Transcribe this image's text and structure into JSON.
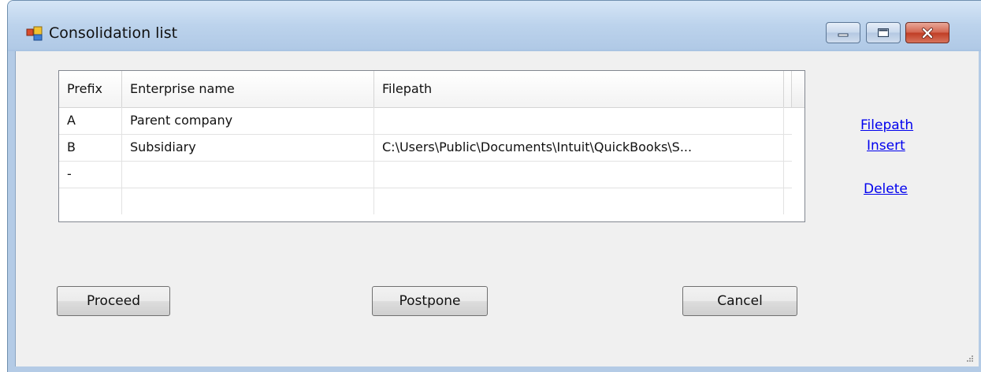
{
  "window": {
    "title": "Consolidation list"
  },
  "grid": {
    "columns": [
      "Prefix",
      "Enterprise name",
      "Filepath"
    ],
    "rows": [
      [
        "A",
        "Parent company",
        ""
      ],
      [
        "B",
        "Subsidiary",
        "C:\\Users\\Public\\Documents\\Intuit\\QuickBooks\\S..."
      ],
      [
        "-",
        "",
        ""
      ]
    ]
  },
  "links": {
    "filepath": "Filepath",
    "insert": "Insert",
    "delete": "Delete"
  },
  "buttons": {
    "proceed": "Proceed",
    "postpone": "Postpone",
    "cancel": "Cancel"
  },
  "colors": {
    "link": "#0000ee",
    "close_button": "#c03c24"
  }
}
